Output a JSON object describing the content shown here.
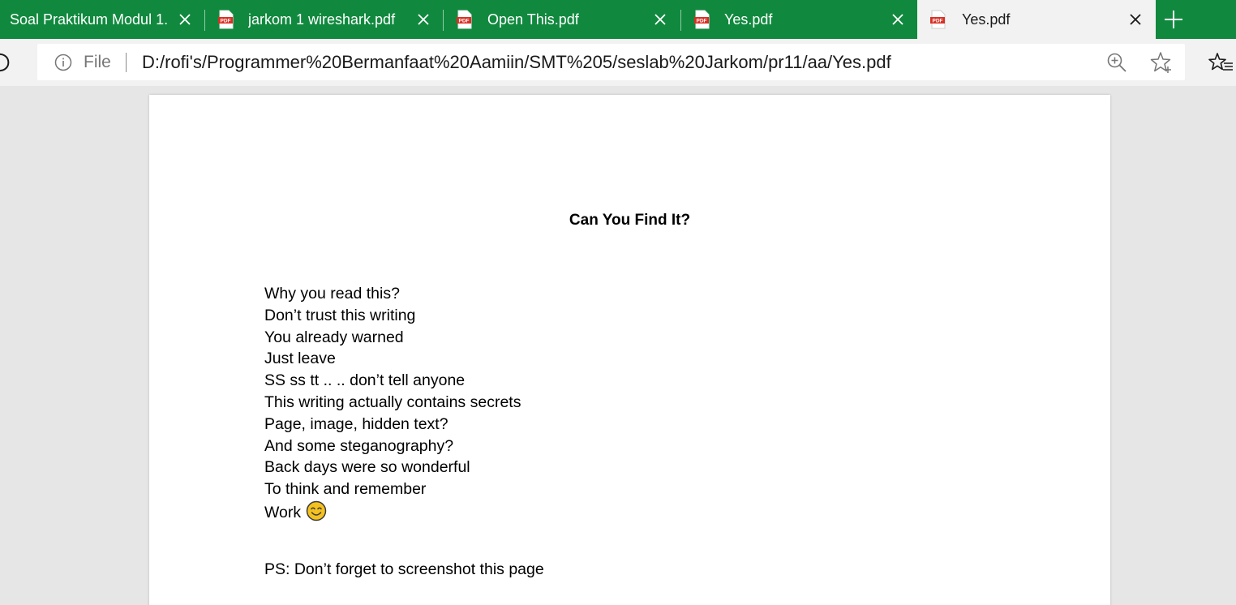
{
  "tabs": [
    {
      "label": "Soal Praktikum Modul 1.",
      "has_icon": false,
      "active": false
    },
    {
      "label": "jarkom 1 wireshark.pdf",
      "has_icon": true,
      "active": false
    },
    {
      "label": "Open This.pdf",
      "has_icon": true,
      "active": false
    },
    {
      "label": "Yes.pdf",
      "has_icon": true,
      "active": false
    },
    {
      "label": "Yes.pdf",
      "has_icon": true,
      "active": true
    }
  ],
  "address_bar": {
    "scheme_label": "File",
    "url": "D:/rofi's/Programmer%20Bermanfaat%20Aamiin/SMT%205/seslab%20Jarkom/pr11/aa/Yes.pdf"
  },
  "document": {
    "title": "Can You Find It?",
    "lines": [
      "Why you read this?",
      "Don’t trust this writing",
      "You already warned",
      "Just leave",
      "SS ss tt .. .. don’t tell anyone",
      "This writing actually contains secrets",
      "Page, image, hidden text?",
      "And some steganography?",
      "Back days were so wonderful",
      "To think and remember",
      "Work"
    ],
    "ps": "PS: Don’t forget to screenshot this page"
  },
  "colors": {
    "tab_bar": "#10893e",
    "active_tab": "#f2f2f2",
    "viewer_bg": "#e6e6e6",
    "pdf_icon": "#d93025",
    "smiley": "#f4c11f"
  },
  "icons": [
    "pdf-file-icon",
    "close-icon",
    "plus-icon",
    "refresh-icon",
    "info-icon",
    "zoom-in-icon",
    "add-favorite-icon",
    "favorites-list-icon",
    "smiley-emoji-icon"
  ]
}
